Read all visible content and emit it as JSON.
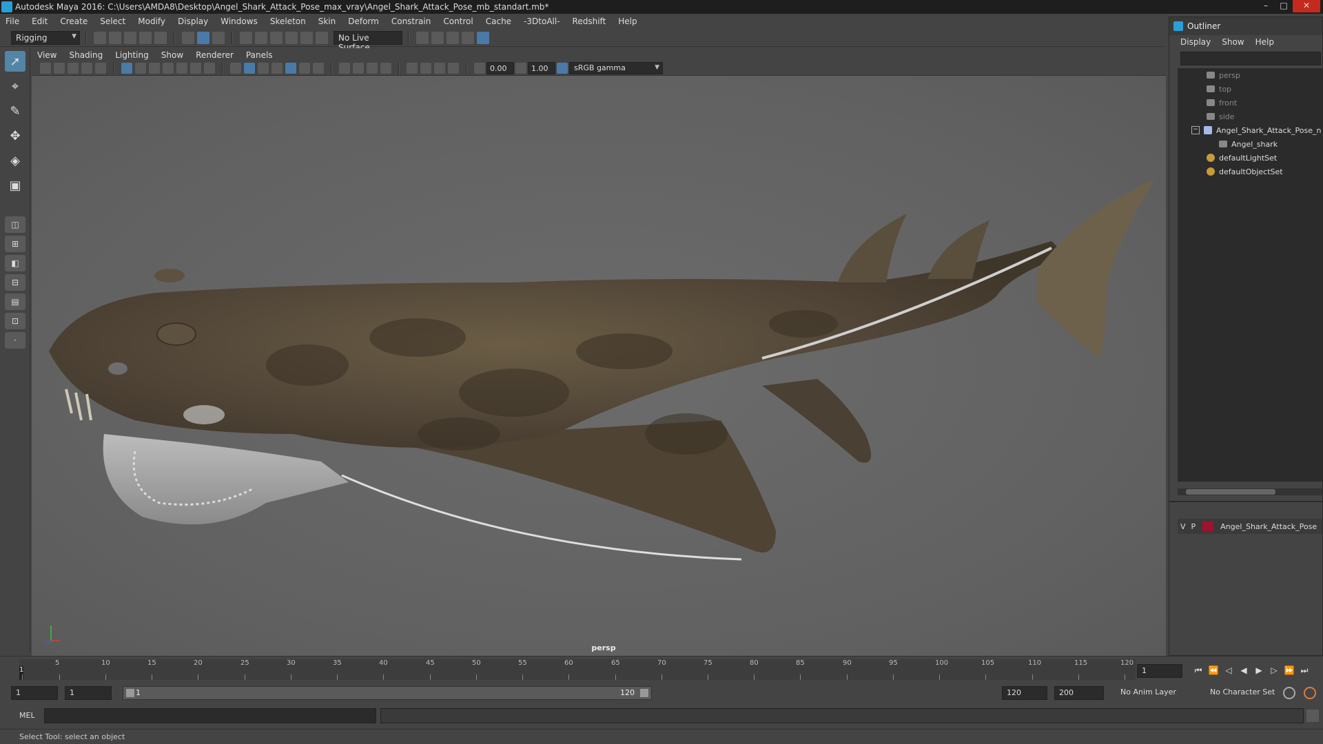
{
  "window": {
    "title": "Autodesk Maya 2016: C:\\Users\\AMDA8\\Desktop\\Angel_Shark_Attack_Pose_max_vray\\Angel_Shark_Attack_Pose_mb_standart.mb*",
    "minimize": "–",
    "maximize": "□",
    "close": "✕"
  },
  "menubar": [
    "File",
    "Edit",
    "Create",
    "Select",
    "Modify",
    "Display",
    "Windows",
    "Skeleton",
    "Skin",
    "Deform",
    "Constrain",
    "Control",
    "Cache",
    "-3DtoAll-",
    "Redshift",
    "Help"
  ],
  "shelf": {
    "mode": "Rigging",
    "live_surface": "No Live Surface"
  },
  "panel_menu": [
    "View",
    "Shading",
    "Lighting",
    "Show",
    "Renderer",
    "Panels"
  ],
  "panel_toolbar": {
    "exposure": "0.00",
    "gamma": "1.00",
    "color_space": "sRGB gamma"
  },
  "viewport": {
    "camera": "persp"
  },
  "outliner": {
    "title": "Outliner",
    "menu": [
      "Display",
      "Show",
      "Help"
    ],
    "items": [
      {
        "label": "persp",
        "kind": "camera",
        "dim": true
      },
      {
        "label": "top",
        "kind": "camera",
        "dim": true
      },
      {
        "label": "front",
        "kind": "camera",
        "dim": true
      },
      {
        "label": "side",
        "kind": "camera",
        "dim": true
      },
      {
        "label": "Angel_Shark_Attack_Pose_n",
        "kind": "joint",
        "dim": false
      },
      {
        "label": "Angel_shark",
        "kind": "mesh",
        "dim": false
      },
      {
        "label": "defaultLightSet",
        "kind": "set",
        "dim": false
      },
      {
        "label": "defaultObjectSet",
        "kind": "set",
        "dim": false
      }
    ]
  },
  "layers": {
    "v": "V",
    "p": "P",
    "name": "Angel_Shark_Attack_Pose",
    "color": "#a0132a"
  },
  "timeline": {
    "labels": [
      "1",
      "5",
      "10",
      "15",
      "20",
      "25",
      "30",
      "35",
      "40",
      "45",
      "50",
      "55",
      "60",
      "65",
      "70",
      "75",
      "80",
      "85",
      "90",
      "95",
      "100",
      "105",
      "110",
      "115",
      "120"
    ],
    "current_frame": "1"
  },
  "range": {
    "start": "1",
    "playback_start": "1",
    "slider_start": "1",
    "slider_end": "120",
    "playback_end": "120",
    "end": "200",
    "anim_layer": "No Anim Layer",
    "character_set": "No Character Set"
  },
  "command": {
    "lang": "MEL"
  },
  "help_line": "Select Tool: select an object"
}
